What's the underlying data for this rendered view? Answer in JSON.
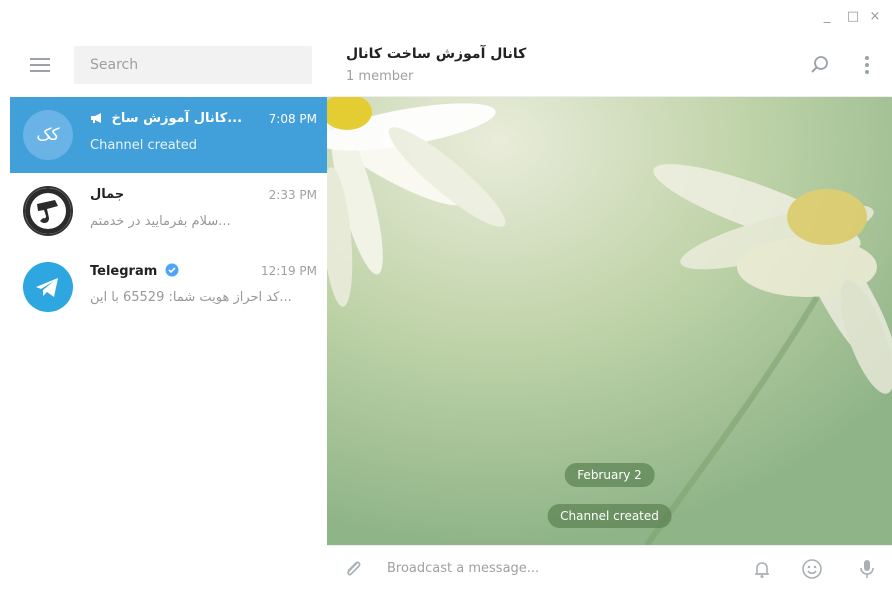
{
  "window": {
    "minimize": "_",
    "maximize": "□",
    "close": "×"
  },
  "sidebar": {
    "search": {
      "placeholder": "Search"
    },
    "chats": [
      {
        "name": "کانال آموزش ساخ...",
        "avatar_text": "کک",
        "time": "7:08 PM",
        "preview": "Channel created",
        "active": true,
        "icon": "megaphone-icon"
      },
      {
        "name": "جمال",
        "time": "2:33 PM",
        "preview": "سلام بفرمایید در خدمتم...",
        "active": false
      },
      {
        "name": "Telegram",
        "time": "12:19 PM",
        "preview": "کد احراز هویت شما: 65529 با این...",
        "active": false,
        "verified": true,
        "icon": "telegram-logo"
      }
    ]
  },
  "header": {
    "title": "کانال آموزش ساخت کانال",
    "subtitle": "1 member"
  },
  "messages": {
    "date": "February 2",
    "service": "Channel created"
  },
  "composer": {
    "placeholder": "Broadcast a message..."
  },
  "colors": {
    "accent": "#419fd9",
    "pill": "#5c8252"
  }
}
